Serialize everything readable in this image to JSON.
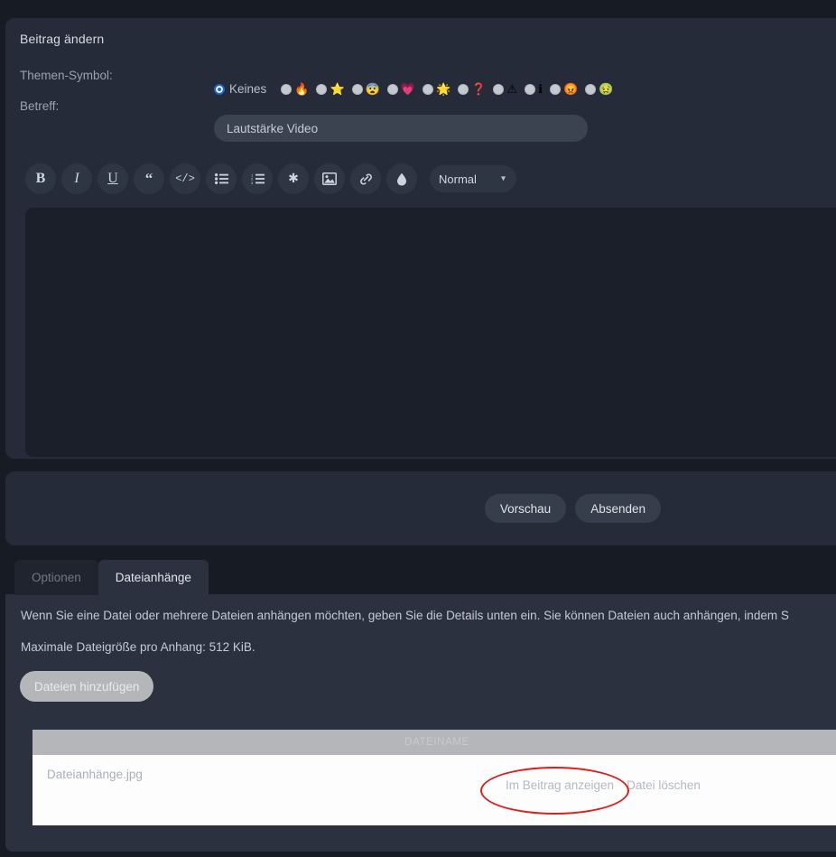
{
  "page": {
    "title": "Beitrag ändern",
    "background_color": "#171b24",
    "panel_color": "#252b38"
  },
  "form": {
    "symbol_label": "Themen-Symbol:",
    "subject_label": "Betreff:",
    "subject_value": "Lautstärke Video",
    "subject_placeholder": "",
    "symbols": [
      {
        "name": "none",
        "label": "Keines",
        "glyph": "",
        "selected": true
      },
      {
        "name": "fire-icon",
        "label": "",
        "glyph": "🔥",
        "selected": false
      },
      {
        "name": "star-icon",
        "label": "",
        "glyph": "⭐",
        "selected": false
      },
      {
        "name": "surprised-face-icon",
        "label": "",
        "glyph": "😨",
        "selected": false
      },
      {
        "name": "heart-icon",
        "label": "",
        "glyph": "💗",
        "selected": false
      },
      {
        "name": "sun-icon",
        "label": "",
        "glyph": "🌟",
        "selected": false
      },
      {
        "name": "question-mark-icon",
        "label": "",
        "glyph": "❓",
        "selected": false
      },
      {
        "name": "warning-triangle-icon",
        "label": "",
        "glyph": "⚠",
        "selected": false
      },
      {
        "name": "info-icon",
        "label": "",
        "glyph": "ℹ",
        "selected": false
      },
      {
        "name": "red-face-icon",
        "label": "",
        "glyph": "😡",
        "selected": false
      },
      {
        "name": "green-face-icon",
        "label": "",
        "glyph": "🤢",
        "selected": false
      }
    ]
  },
  "editor": {
    "content": "",
    "format_selected": "Normal",
    "format_options": [
      "Normal"
    ],
    "toolbar": [
      {
        "name": "bold-button",
        "label": "B"
      },
      {
        "name": "italic-button",
        "label": "I"
      },
      {
        "name": "underline-button",
        "label": "U"
      },
      {
        "name": "quote-button",
        "label": "“"
      },
      {
        "name": "code-button",
        "label": "</>"
      },
      {
        "name": "bullet-list-button",
        "label": ""
      },
      {
        "name": "numbered-list-button",
        "label": ""
      },
      {
        "name": "asterisk-button",
        "label": "✱"
      },
      {
        "name": "image-button",
        "label": ""
      },
      {
        "name": "link-button",
        "label": ""
      },
      {
        "name": "color-drop-button",
        "label": ""
      }
    ]
  },
  "actions": {
    "preview_label": "Vorschau",
    "submit_label": "Absenden"
  },
  "tabs": [
    {
      "name": "tab-optionen",
      "label": "Optionen",
      "active": false
    },
    {
      "name": "tab-dateianhaenge",
      "label": "Dateianhänge",
      "active": true
    }
  ],
  "attachments": {
    "description": "Wenn Sie eine Datei oder mehrere Dateien anhängen möchten, geben Sie die Details unten ein. Sie können Dateien auch anhängen, indem S",
    "max_size_text": "Maximale Dateigröße pro Anhang: 512 KiB.",
    "add_files_label": "Dateien hinzufügen",
    "table": {
      "header": "DATEINAME",
      "rows": [
        {
          "file_name": "Dateianhänge.jpg",
          "show_in_post_label": "Im Beitrag anzeigen",
          "delete_label": "Datei löschen"
        }
      ]
    }
  },
  "annotation": {
    "shape": "ellipse",
    "color": "#e21b1b",
    "target": "Im Beitrag anzeigen"
  }
}
